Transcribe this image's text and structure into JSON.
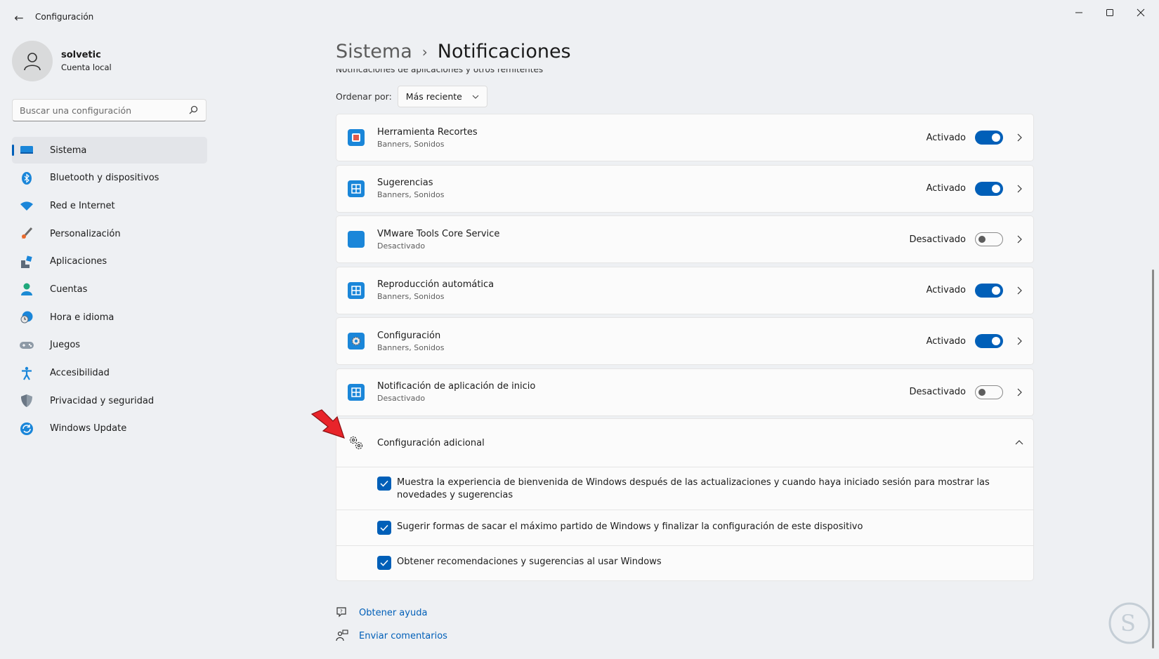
{
  "window": {
    "title": "Configuración"
  },
  "profile": {
    "name": "solvetic",
    "type": "Cuenta local"
  },
  "search": {
    "placeholder": "Buscar una configuración"
  },
  "sidebar": {
    "items": [
      {
        "label": "Sistema",
        "icon": "system-icon",
        "active": true
      },
      {
        "label": "Bluetooth y dispositivos",
        "icon": "bluetooth-icon"
      },
      {
        "label": "Red e Internet",
        "icon": "wifi-icon"
      },
      {
        "label": "Personalización",
        "icon": "brush-icon"
      },
      {
        "label": "Aplicaciones",
        "icon": "apps-icon"
      },
      {
        "label": "Cuentas",
        "icon": "accounts-icon"
      },
      {
        "label": "Hora e idioma",
        "icon": "time-language-icon"
      },
      {
        "label": "Juegos",
        "icon": "gamepad-icon"
      },
      {
        "label": "Accesibilidad",
        "icon": "accessibility-icon"
      },
      {
        "label": "Privacidad y seguridad",
        "icon": "shield-icon"
      },
      {
        "label": "Windows Update",
        "icon": "update-icon"
      }
    ]
  },
  "breadcrumb": {
    "parent": "Sistema",
    "separator": "›",
    "current": "Notificaciones"
  },
  "section": {
    "title": "Notificaciones de aplicaciones y otros remitentes"
  },
  "sort": {
    "label": "Ordenar por:",
    "value": "Más reciente"
  },
  "apps": [
    {
      "name": "Herramienta Recortes",
      "sub": "Banners, Sonidos",
      "state": "Activado",
      "on": true,
      "icon": "snipping-tool-icon"
    },
    {
      "name": "Sugerencias",
      "sub": "Banners, Sonidos",
      "state": "Activado",
      "on": true,
      "icon": "app-grid-icon"
    },
    {
      "name": "VMware Tools Core Service",
      "sub": "Desactivado",
      "state": "Desactivado",
      "on": false,
      "icon": "vmware-icon"
    },
    {
      "name": "Reproducción automática",
      "sub": "Banners, Sonidos",
      "state": "Activado",
      "on": true,
      "icon": "app-grid-icon"
    },
    {
      "name": "Configuración",
      "sub": "Banners, Sonidos",
      "state": "Activado",
      "on": true,
      "icon": "settings-gear-icon"
    },
    {
      "name": "Notificación de aplicación de inicio",
      "sub": "Desactivado",
      "state": "Desactivado",
      "on": false,
      "icon": "app-grid-icon"
    }
  ],
  "extra": {
    "title": "Configuración adicional",
    "options": [
      {
        "label": "Muestra la experiencia de bienvenida de Windows después de las actualizaciones y cuando haya iniciado sesión para mostrar las novedades y sugerencias",
        "checked": true
      },
      {
        "label": "Sugerir formas de sacar el máximo partido de Windows y finalizar la configuración de este dispositivo",
        "checked": true
      },
      {
        "label": "Obtener recomendaciones y sugerencias al usar Windows",
        "checked": true
      }
    ]
  },
  "links": {
    "help": "Obtener ayuda",
    "feedback": "Enviar comentarios"
  },
  "colors": {
    "accent": "#005fb8",
    "arrow": "#e8242a"
  }
}
